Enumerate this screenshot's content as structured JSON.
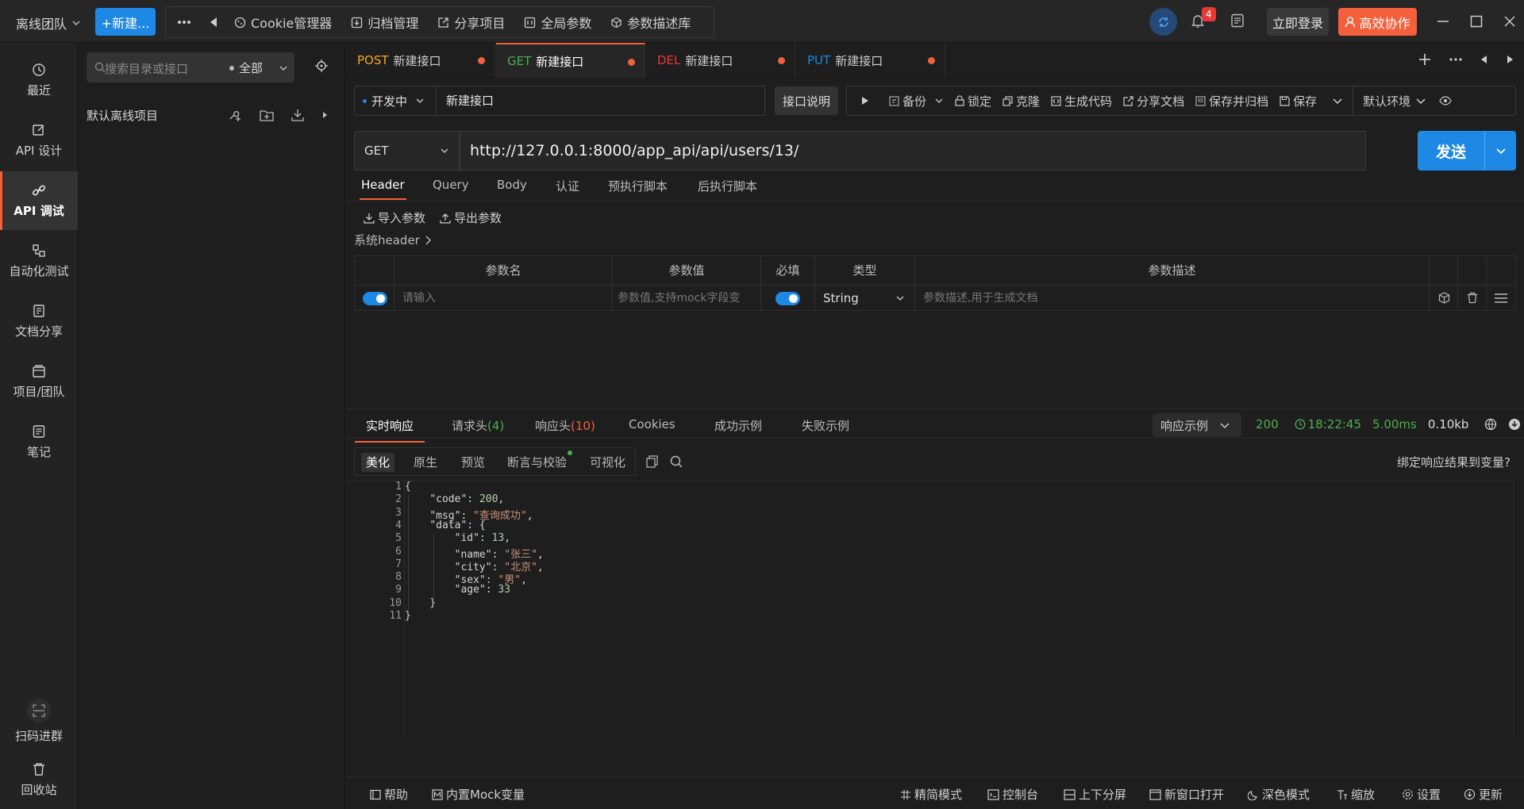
{
  "topbar": {
    "team": "离线团队",
    "new_button": "+新建...",
    "tools": [
      "Cookie管理器",
      "归档管理",
      "分享项目",
      "全局参数",
      "参数描述库"
    ],
    "bell_count": "4",
    "login": "立即登录",
    "collab": "高效协作"
  },
  "leftnav": {
    "items": [
      "最近",
      "API 设计",
      "API 调试",
      "自动化测试",
      "文档分享",
      "项目/团队",
      "笔记"
    ],
    "scan": "扫码进群",
    "trash": "回收站"
  },
  "project": {
    "search_placeholder": "搜索目录或接口",
    "scope": "全部",
    "default_project": "默认离线项目"
  },
  "tabs": [
    {
      "method": "POST",
      "name": "新建接口",
      "color": "#f5a623"
    },
    {
      "method": "GET",
      "name": "新建接口",
      "color": "#4caf50"
    },
    {
      "method": "DEL",
      "name": "新建接口",
      "color": "#e53935"
    },
    {
      "method": "PUT",
      "name": "新建接口",
      "color": "#1e88e5"
    }
  ],
  "request": {
    "status": "开发中",
    "name": "新建接口",
    "desc_button": "接口说明",
    "actions": [
      "备份",
      "锁定",
      "克隆",
      "生成代码",
      "分享文档",
      "保存并归档",
      "保存"
    ],
    "env": "默认环境",
    "method": "GET",
    "url": "http://127.0.0.1:8000/app_api/api/users/13/",
    "send": "发送",
    "tabs": [
      "Header",
      "Query",
      "Body",
      "认证",
      "预执行脚本",
      "后执行脚本"
    ],
    "import": "导入参数",
    "export": "导出参数",
    "system_header": "系统header",
    "table": {
      "headers": [
        "参数名",
        "参数值",
        "必填",
        "类型",
        "参数描述"
      ],
      "row": {
        "name_ph": "请输入",
        "value_ph": "参数值,支持mock字段变",
        "type": "String",
        "desc_ph": "参数描述,用于生成文档"
      }
    }
  },
  "response": {
    "tabs": [
      "实时响应",
      "请求头",
      "响应头",
      "Cookies",
      "成功示例",
      "失败示例"
    ],
    "req_header_count": "(4)",
    "resp_header_count": "(10)",
    "example": "响应示例",
    "status_code": "200",
    "time": "18:22:45",
    "duration": "5.00ms",
    "size": "0.10kb",
    "view_tabs": [
      "美化",
      "原生",
      "预览",
      "断言与校验",
      "可视化"
    ],
    "bind": "绑定响应结果到变量?",
    "code_lines": [
      "{",
      "    \"code\": 200,",
      "    \"msg\": \"查询成功\",",
      "    \"data\": {",
      "        \"id\": 13,",
      "        \"name\": \"张三\",",
      "        \"city\": \"北京\",",
      "        \"sex\": \"男\",",
      "        \"age\": 33",
      "    }",
      "}"
    ]
  },
  "bottombar": {
    "left": [
      "帮助",
      "内置Mock变量"
    ],
    "right": [
      "精简模式",
      "控制台",
      "上下分屏",
      "新窗口打开",
      "深色模式",
      "缩放",
      "设置",
      "更新"
    ]
  }
}
